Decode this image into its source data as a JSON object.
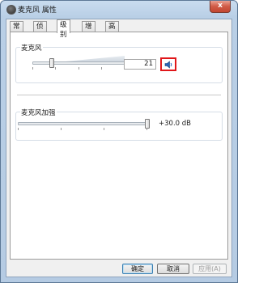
{
  "window": {
    "title": "麦克风 属性",
    "close_label": "x"
  },
  "tabs": [
    {
      "label": "常规",
      "active": false
    },
    {
      "label": "侦听",
      "active": false
    },
    {
      "label": "级别",
      "active": true
    },
    {
      "label": "增强",
      "active": false
    },
    {
      "label": "高级",
      "active": false
    }
  ],
  "microphone": {
    "label": "麦克风",
    "value": "21",
    "level_percent": 21,
    "speaker_icon": "speaker-icon"
  },
  "boost": {
    "label": "麦克风加强",
    "value": "+30.0 dB",
    "level_fraction": 1.0
  },
  "buttons": {
    "ok": "确定",
    "cancel": "取消",
    "apply": "应用(A)"
  },
  "colors": {
    "highlight_border": "#e0171a"
  }
}
